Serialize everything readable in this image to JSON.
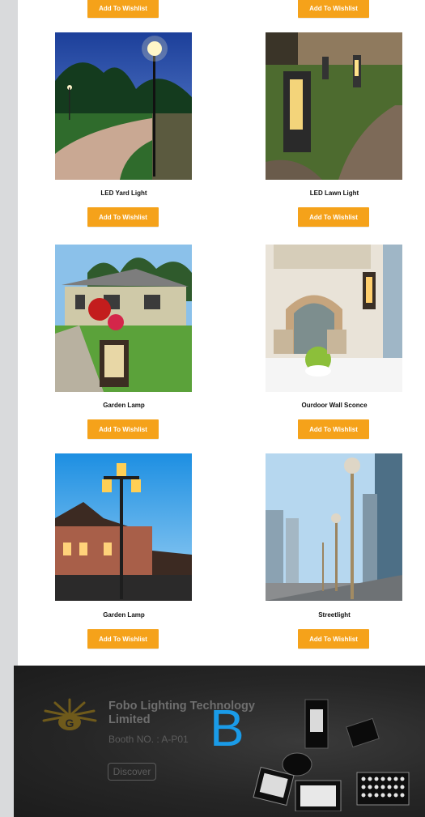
{
  "wishlist_label": "Add To Wishlist",
  "products": [
    {
      "name": "LED Yard Light"
    },
    {
      "name": "LED Lawn Light"
    },
    {
      "name": "Garden Lamp"
    },
    {
      "name": "Ourdoor Wall Sconce"
    },
    {
      "name": "Garden Lamp"
    },
    {
      "name": "Streetlight"
    }
  ],
  "banner": {
    "company": "Fobo Lighting Technology Limited",
    "booth": "Booth NO. : A-P01",
    "discover_label": "Discover",
    "badge": "B"
  },
  "colors": {
    "accent": "#f5a21a",
    "rail": "#d9dadc",
    "banner_bg": "#262626",
    "badge": "#1a9be8"
  }
}
